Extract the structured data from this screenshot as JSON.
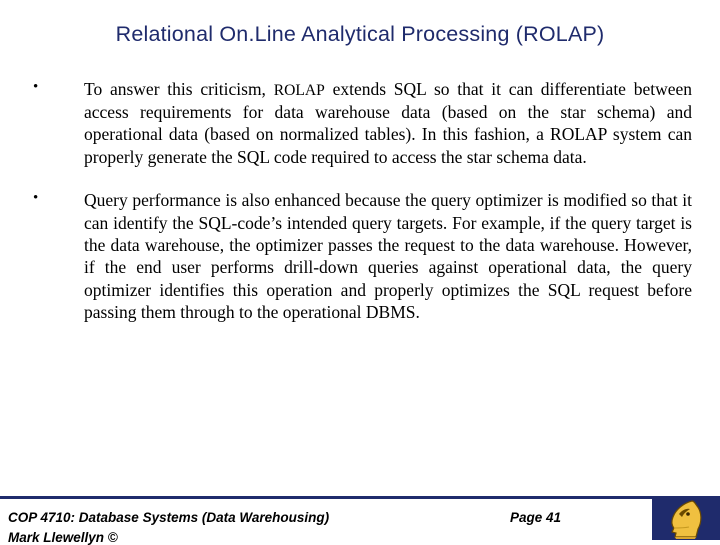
{
  "slide": {
    "title": "Relational On.Line Analytical Processing (ROLAP)",
    "bullets": [
      {
        "marker": "•",
        "text_lead": "To answer this criticism, ",
        "text_caps": "ROLAP",
        "text_rest": " extends SQL so that it can differentiate between access requirements for data warehouse data (based on the star schema) and operational data (based on normalized tables).  In this fashion, a ROLAP system can properly generate the SQL code required to access the star schema data."
      },
      {
        "marker": "•",
        "text_lead": "",
        "text_caps": "",
        "text_rest": "Query performance is also enhanced because the query optimizer is modified so that it can identify the SQL-code’s intended query targets.  For example, if the query target is the data warehouse, the optimizer passes the request to the data warehouse.  However, if the end user performs drill-down queries against operational data, the query optimizer identifies this operation and properly optimizes the SQL request before passing them through to the operational DBMS."
      }
    ]
  },
  "footer": {
    "course": "COP 4710: Database Systems  (Data Warehousing)",
    "page": "Page 41",
    "author": "Mark Llewellyn ©",
    "accent_color": "#1f2b6c"
  }
}
